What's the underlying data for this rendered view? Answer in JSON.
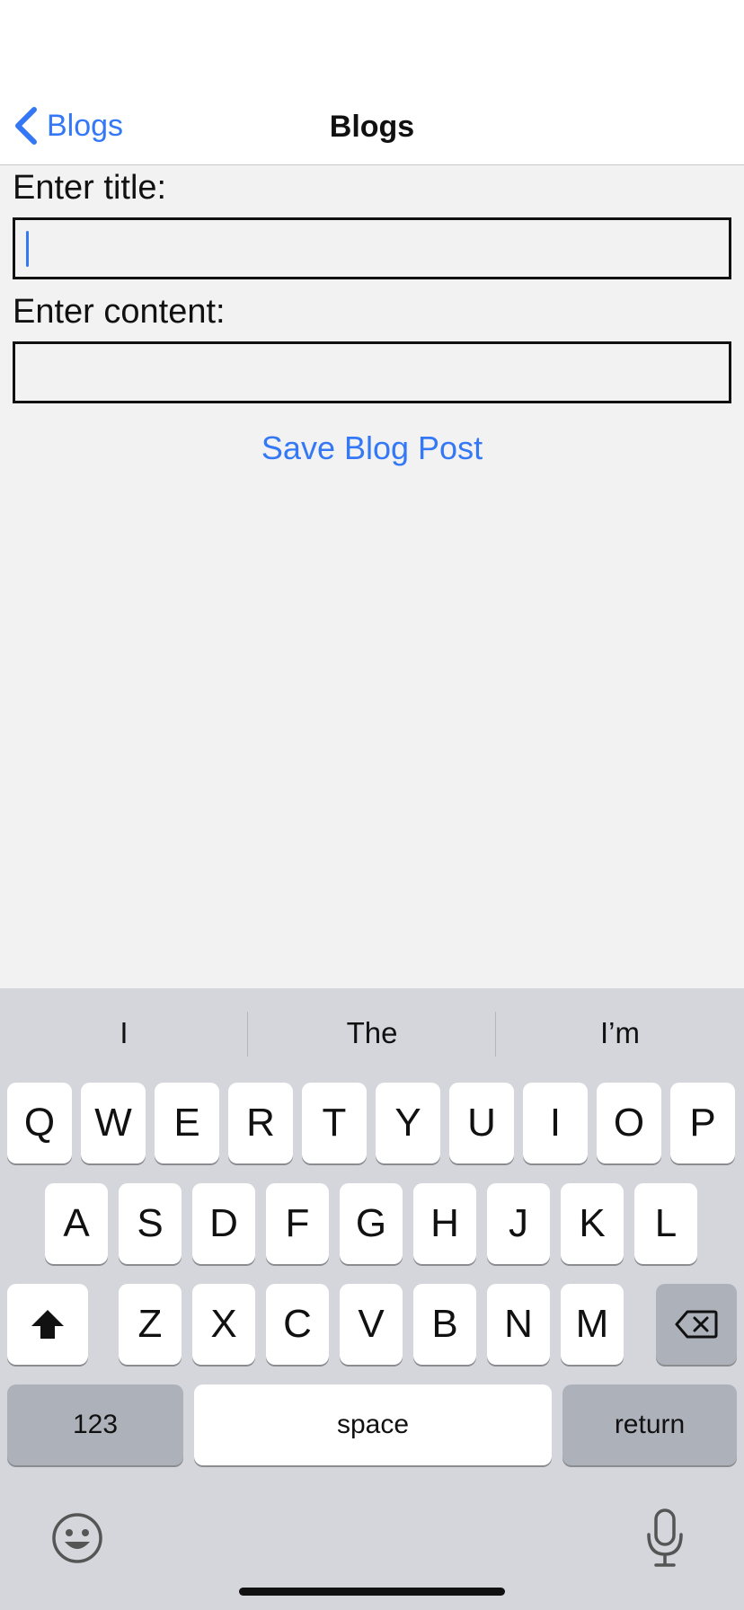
{
  "nav": {
    "back_label": "Blogs",
    "title": "Blogs"
  },
  "form": {
    "title_label": "Enter title:",
    "title_value": "",
    "content_label": "Enter content:",
    "content_value": "",
    "save_label": "Save Blog Post"
  },
  "keyboard": {
    "suggestions": [
      "I",
      "The",
      "I’m"
    ],
    "row1": [
      "Q",
      "W",
      "E",
      "R",
      "T",
      "Y",
      "U",
      "I",
      "O",
      "P"
    ],
    "row2": [
      "A",
      "S",
      "D",
      "F",
      "G",
      "H",
      "J",
      "K",
      "L"
    ],
    "row3": [
      "Z",
      "X",
      "C",
      "V",
      "B",
      "N",
      "M"
    ],
    "numbers_label": "123",
    "space_label": "space",
    "return_label": "return"
  },
  "colors": {
    "accent": "#3478f6",
    "background": "#f2f2f2",
    "keyboard_background": "#d4d6dc"
  }
}
